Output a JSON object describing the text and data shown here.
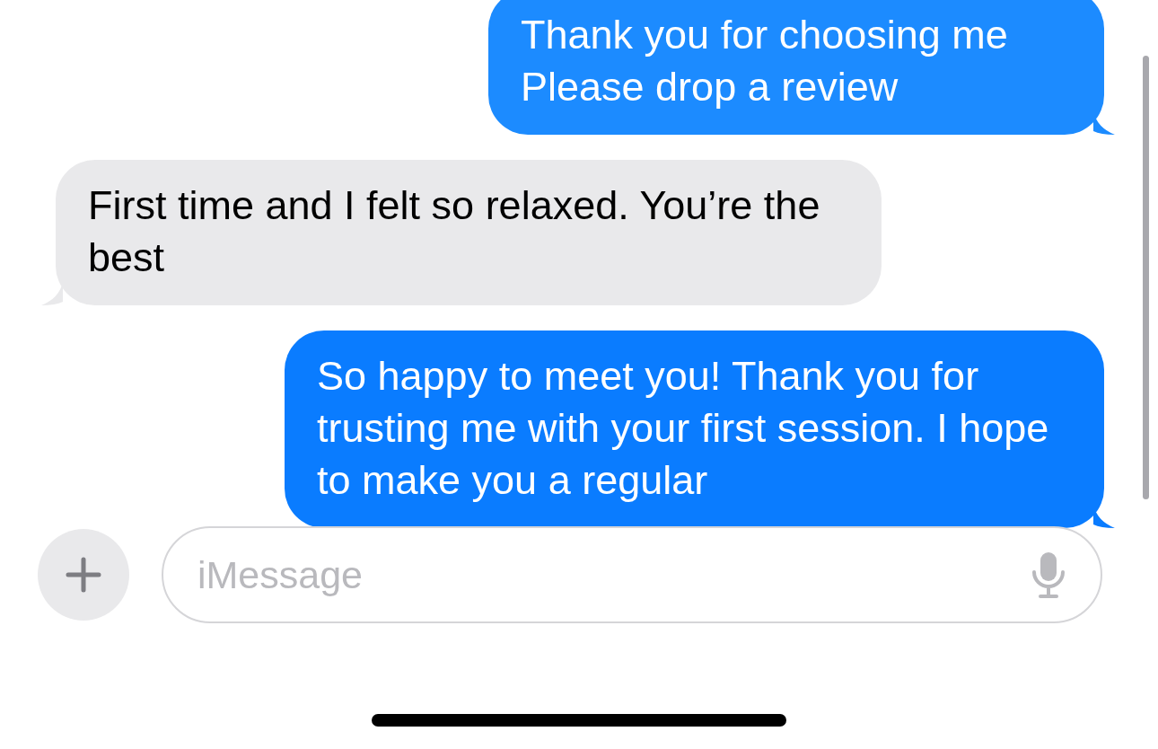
{
  "messages": [
    {
      "kind": "sent",
      "text": "Thank you for choosing me Please drop a review"
    },
    {
      "kind": "received",
      "text": "First time and I felt so relaxed. You’re the best"
    },
    {
      "kind": "sent",
      "text": "So happy to meet you! Thank you for trusting me with your first session. I hope to make you a regular"
    }
  ],
  "composer": {
    "placeholder": "iMessage"
  }
}
